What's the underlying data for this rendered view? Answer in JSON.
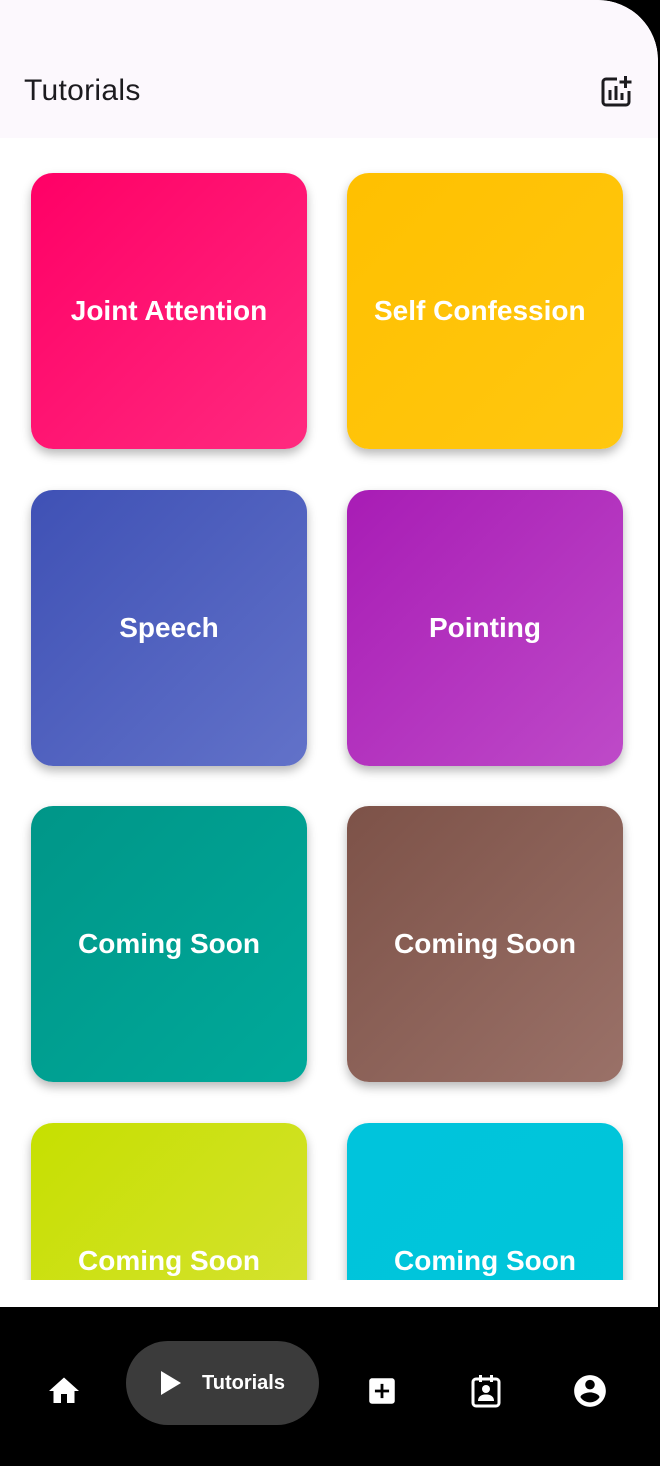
{
  "app_bar": {
    "title": "Tutorials",
    "action_icon": "analytics-add-icon"
  },
  "tiles": [
    {
      "label": "Joint Attention",
      "gradient": [
        "#ff0066",
        "#ff2a7f"
      ]
    },
    {
      "label": "Self Confession",
      "gradient": [
        "#ffc000",
        "#ffc710"
      ]
    },
    {
      "label": "Speech",
      "gradient": [
        "#3f51b5",
        "#6272c9"
      ]
    },
    {
      "label": "Pointing",
      "gradient": [
        "#a81cb5",
        "#be4ac8"
      ]
    },
    {
      "label": "Coming Soon",
      "gradient": [
        "#009688",
        "#00a99a"
      ]
    },
    {
      "label": "Coming Soon",
      "gradient": [
        "#7d5248",
        "#9a7168"
      ]
    },
    {
      "label": "Coming Soon",
      "gradient": [
        "#c6e000",
        "#d8e23a"
      ]
    },
    {
      "label": "Coming Soon",
      "gradient": [
        "#00c4dc",
        "#00c6d9"
      ]
    }
  ],
  "bottom_nav": {
    "items": [
      {
        "icon": "home-icon"
      },
      {
        "icon": "play-icon",
        "label": "Tutorials",
        "selected": true
      },
      {
        "icon": "add-box-icon"
      },
      {
        "icon": "contact-calendar-icon"
      },
      {
        "icon": "account-circle-icon"
      }
    ]
  },
  "colors": {
    "app_bar_bg": "#fcf8fd",
    "nav_bg": "#000000",
    "nav_pill": "#3b3b3b"
  }
}
